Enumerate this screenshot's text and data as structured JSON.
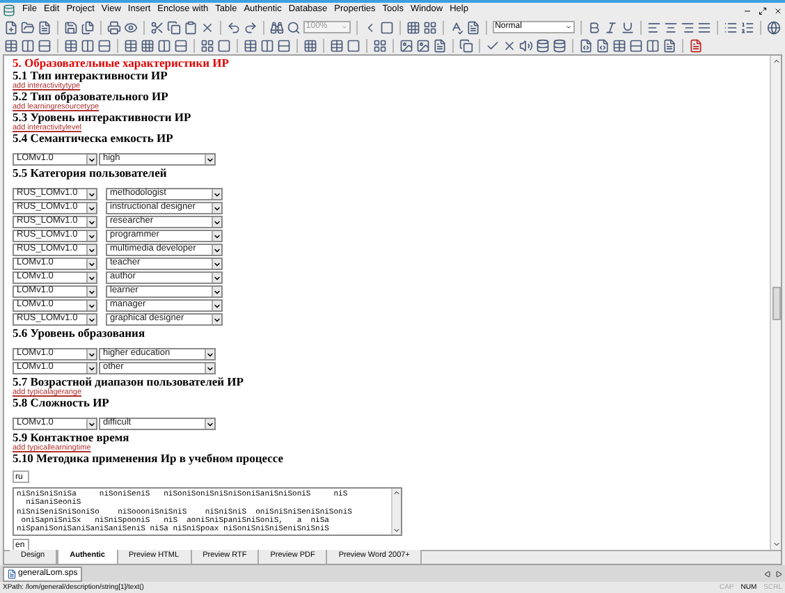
{
  "menu": [
    "File",
    "Edit",
    "Project",
    "View",
    "Insert",
    "Enclose with",
    "Table",
    "Authentic",
    "Database",
    "Properties",
    "Tools",
    "Window",
    "Help"
  ],
  "toolbar": {
    "zoom": "100%",
    "style": "Normal"
  },
  "document": [
    {
      "kind": "title",
      "text": "5. Образовательные характеристики ИР"
    },
    {
      "kind": "heading",
      "text": "5.1 Тип интерактивности ИР"
    },
    {
      "kind": "link",
      "text": "add interactivitytype"
    },
    {
      "kind": "heading",
      "text": "5.2 Тип образовательного ИР"
    },
    {
      "kind": "link",
      "text": "add learningresourcetype"
    },
    {
      "kind": "heading",
      "text": "5.3 Уровень интерактивности ИР"
    },
    {
      "kind": "link",
      "text": "add interactivitylevel"
    },
    {
      "kind": "heading",
      "text": "5.4 Семантическа емкость ИР"
    },
    {
      "kind": "selects",
      "rows": [
        {
          "source": "LOMv1.0",
          "value": "high"
        }
      ]
    },
    {
      "kind": "heading",
      "text": "5.5 Категория пользователей"
    },
    {
      "kind": "spaced_selects",
      "rows": [
        {
          "source": "RUS_LOMv1.0",
          "value": "methodologist"
        },
        {
          "source": "RUS_LOMv1.0",
          "value": "instructional designer"
        },
        {
          "source": "RUS_LOMv1.0",
          "value": "researcher"
        },
        {
          "source": "RUS_LOMv1.0",
          "value": "programmer"
        },
        {
          "source": "RUS_LOMv1.0",
          "value": "multimedia developer"
        },
        {
          "source": "LOMv1.0",
          "value": "teacher"
        },
        {
          "source": "LOMv1.0",
          "value": "author"
        },
        {
          "source": "LOMv1.0",
          "value": "learner"
        },
        {
          "source": "LOMv1.0",
          "value": "manager"
        },
        {
          "source": "RUS_LOMv1.0",
          "value": "graphical designer"
        }
      ]
    },
    {
      "kind": "heading",
      "text": "5.6 Уровень образования"
    },
    {
      "kind": "selects",
      "rows": [
        {
          "source": "LOMv1.0",
          "value": "higher education"
        },
        {
          "source": "LOMv1.0",
          "value": "other"
        }
      ]
    },
    {
      "kind": "heading",
      "text": "5.7 Возрастной диапазон пользователей ИР"
    },
    {
      "kind": "link",
      "text": "add typicalagerange"
    },
    {
      "kind": "heading",
      "text": "5.8 Сложность ИР"
    },
    {
      "kind": "selects",
      "rows": [
        {
          "source": "LOMv1.0",
          "value": "difficult"
        }
      ]
    },
    {
      "kind": "heading",
      "text": "5.9 Контактное время"
    },
    {
      "kind": "link",
      "text": "add typicallearningtime"
    },
    {
      "kind": "heading",
      "text": "5.10 Методика применения Ир в учебном процессе"
    }
  ],
  "description": {
    "language": "ru",
    "lines": [
      "niSniSniSniSa     niSoniSeniS   niSoniSoniSniSniSoniSaniSniSoniS     niS",
      "  niSaniSeoniS",
      "niSniSeniSniSoniSo    niSoooniSniSniS    niSniSniS  oniSniSniSeniSniSoniS",
      " oniSapniSniSx   niSniSpooniS   niS  aoniSniSpaniSniSoniS,   a  niSa",
      "niSpaniSoniSaniSaniSaniSeniS niSa niSniSpoax niSoniSniSniSeniSniSniS"
    ],
    "next_language": "en"
  },
  "tabs": [
    {
      "label": "Design",
      "selected": false
    },
    {
      "label": "Authentic",
      "selected": true
    },
    {
      "label": "Preview HTML",
      "selected": false
    },
    {
      "label": "Preview RTF",
      "selected": false
    },
    {
      "label": "Preview PDF",
      "selected": false
    },
    {
      "label": "Preview Word 2007+",
      "selected": false
    }
  ],
  "file_tab": "generalLom.sps",
  "status_bar": {
    "xpath": "XPath: /lom/general/description/string[1]/text()",
    "indicators": [
      {
        "label": "CAP",
        "on": false
      },
      {
        "label": "NUM",
        "on": true
      },
      {
        "label": "SCRL",
        "on": false
      }
    ]
  }
}
